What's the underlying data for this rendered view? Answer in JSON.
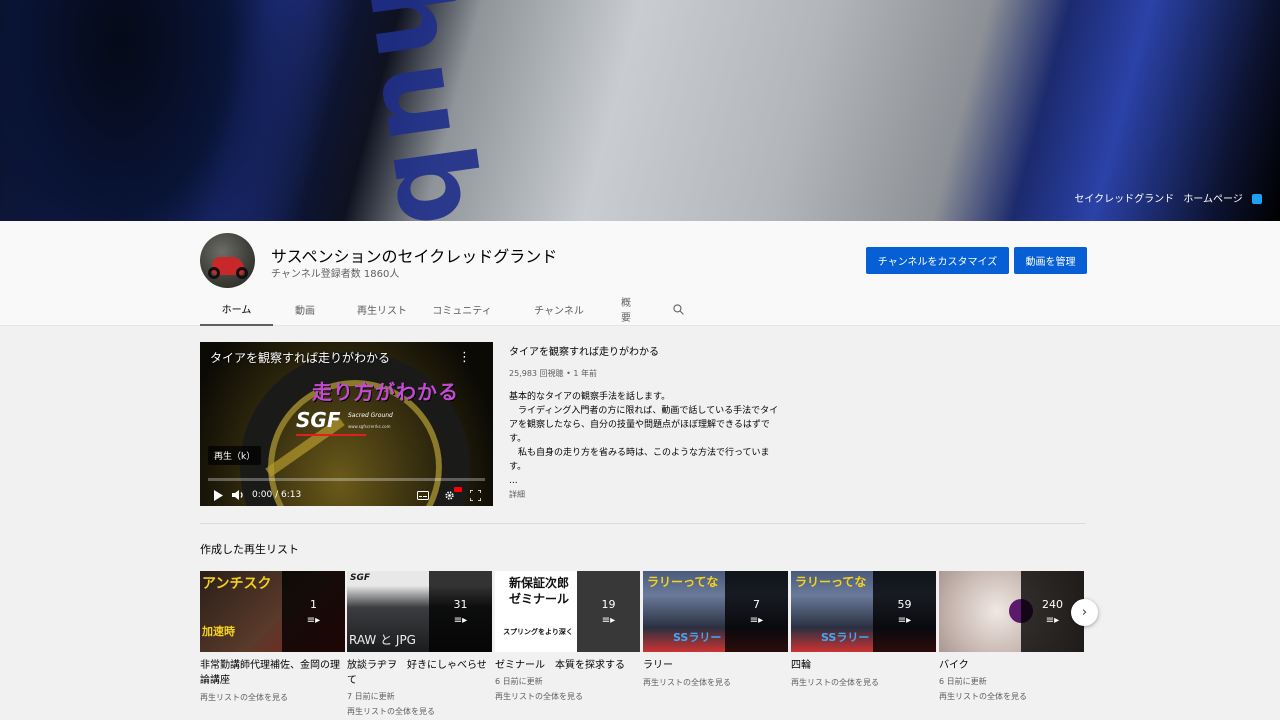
{
  "banner": {
    "text": "hub SusP",
    "links": [
      "セイクレッドグランド",
      "ホームページ"
    ]
  },
  "channel": {
    "name": "サスペンションのセイクレッドグランド",
    "subscribers": "チャンネル登録者数 1860人",
    "customize_label": "チャンネルをカスタマイズ",
    "manage_label": "動画を管理"
  },
  "tabs": [
    {
      "label": "ホーム",
      "active": true
    },
    {
      "label": "動画"
    },
    {
      "label": "再生リスト"
    },
    {
      "label": "コミュニティ"
    },
    {
      "label": "チャンネル"
    },
    {
      "label": "概要"
    }
  ],
  "featured": {
    "player_title": "タイアを観察すれば走りがわかる",
    "overlay_big": "走り方がわかる",
    "logo": "SGF",
    "logo_sub": "Sacred Ground",
    "logo_url": "www.sgfscrerrks.com",
    "play_label": "再生（k）",
    "time": "0:00 / 6:13",
    "progress": 0,
    "title": "タイアを観察すれば走りがわかる",
    "meta": "25,983 回視聴 • 1 年前",
    "description": "基本的なタイアの観察手法を話します。\n　ライディング入門者の方に限れば、動画で話している手法でタイアを観察したなら、自分の技量や問題点がほぼ理解できるはずです。\n　私も自身の走り方を省みる時は、このような方法で行っています。\n...",
    "more_label": "詳細"
  },
  "playlists_shelf": {
    "title": "作成した再生リスト",
    "items": [
      {
        "count": "1",
        "name": "非常勤講師代理補佐、金岡の理論講座",
        "updated": "",
        "link": "再生リストの全体を見る",
        "thumb_text": "アンチスク",
        "thumb_sub": "加速時",
        "color": "#3a2a22"
      },
      {
        "count": "31",
        "name": "放談ラヂヲ　好きにしゃべらせて",
        "updated": "7 日前に更新",
        "link": "再生リストの全体を見る",
        "thumb_text": "SGF",
        "thumb_sub": "RAW と JPG",
        "color": "#6b6f76"
      },
      {
        "count": "19",
        "name": "ゼミナール　本質を探求する",
        "updated": "6 日前に更新",
        "link": "再生リストの全体を見る",
        "thumb_text": "新保証次郎 ゼミナール",
        "thumb_sub": "スプリングをより深く",
        "color": "#ffffff"
      },
      {
        "count": "7",
        "name": "ラリー",
        "updated": "",
        "link": "再生リストの全体を見る",
        "thumb_text": "ラリーってな",
        "thumb_sub": "SSラリー",
        "color": "#2a3a55"
      },
      {
        "count": "59",
        "name": "四輪",
        "updated": "",
        "link": "再生リストの全体を見る",
        "thumb_text": "ラリーってな",
        "thumb_sub": "SSラリー",
        "color": "#2a3a55"
      },
      {
        "count": "240",
        "name": "バイク",
        "updated": "6 日前に更新",
        "link": "再生リストの全体を見る",
        "thumb_text": "",
        "thumb_sub": "",
        "color": "#d8d2ce"
      }
    ]
  },
  "icons": {
    "search": "search-icon",
    "play": "play-icon",
    "volume": "volume-icon",
    "subtitles": "subtitles-icon",
    "settings": "settings-icon",
    "fullscreen": "fullscreen-icon",
    "more": "more-vert-icon",
    "next": "chevron-right-icon",
    "playlist": "playlist-icon"
  },
  "colors": {
    "accent": "#065fd4",
    "overlay_text": "#c24bd1"
  }
}
